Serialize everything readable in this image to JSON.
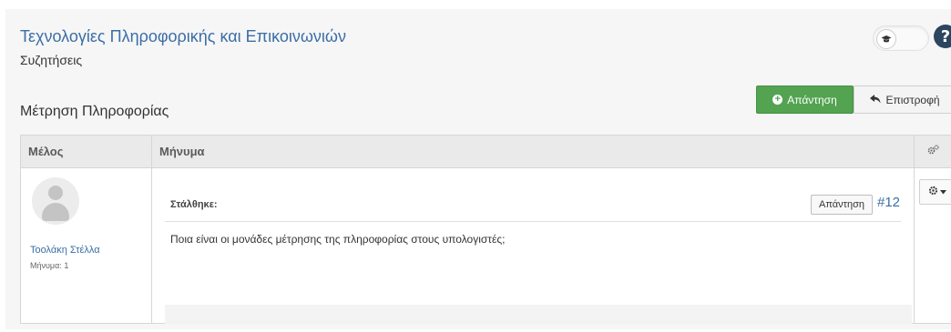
{
  "header": {
    "course_title": "Τεχνολογίες Πληροφορικής και Επικοινωνιών",
    "section": "Συζητήσεις",
    "help_label": "?"
  },
  "topic": {
    "title": "Μέτρηση Πληροφορίας",
    "reply_label": "Απάντηση",
    "back_label": "Επιστροφή"
  },
  "table": {
    "columns": [
      "Μέλος",
      "Μήνυμα"
    ]
  },
  "post": {
    "author": "Τοολάκη Στέλλα",
    "post_count": "Μήνυμα: 1",
    "sent_label": "Στάλθηκε:",
    "reply_label": "Απάντηση",
    "id": "#12",
    "body": "Ποια είναι οι μονάδες μέτρησης της πληροφορίας στους υπολογιστές;"
  },
  "icons": {
    "toggle": "graduation-cap-icon",
    "help": "question-circle-icon",
    "reply": "plus-circle-icon",
    "back": "reply-arrow-icon",
    "header_actions": "cogs-icon",
    "row_actions": "gear-dropdown-icon"
  },
  "colors": {
    "link": "#3b6ea5",
    "reply_button": "#53a351",
    "help": "#2c4660"
  }
}
